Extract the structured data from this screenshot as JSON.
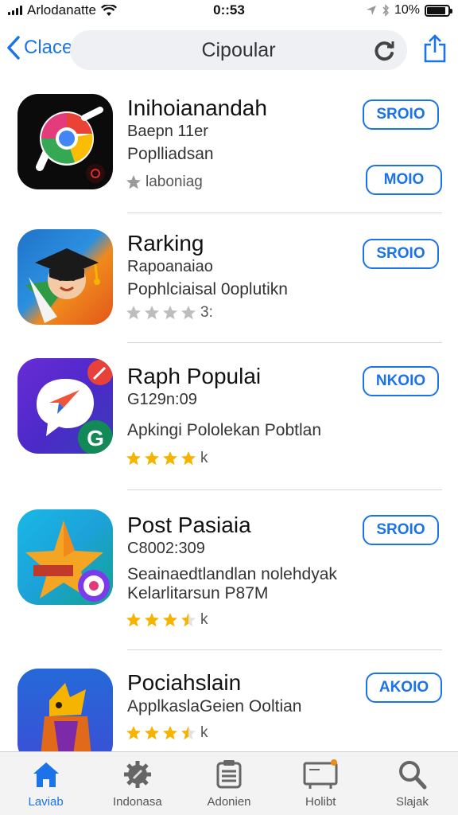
{
  "status_bar": {
    "carrier": "Arlodanatte",
    "time": "0::53",
    "battery": "10%",
    "battery_level": 0.9
  },
  "nav": {
    "back_label": "Clace",
    "title": "Cipoular"
  },
  "apps": [
    {
      "title": "Inihoianandah",
      "line1": "Baepn 11er",
      "line2": "Poplliadsan",
      "rating_text": "laboniag",
      "stars_filled": 1,
      "stars_color": "#9a9a9a",
      "button": "SROIO"
    },
    {
      "title": "Rarking",
      "line1": "Rapoanaiao",
      "line2": "Pophlciaisal 0oplutikn",
      "rating_text": "3:",
      "stars_filled": 4,
      "stars_color": "#bdbdbd",
      "button": "SROIO"
    },
    {
      "title": "Raph Populai",
      "line1": "G129n:09",
      "line2": "Apkingi Pololekan Pobtlan",
      "rating_text": "k",
      "stars_filled": 4,
      "stars_color": "#f5b400",
      "button": "NKOIO"
    },
    {
      "title": "Post Pasiaia",
      "line1": "C8002:309",
      "line2": "Seainaedtlandlan nolehdyak",
      "line3": "Kelarlitarsun P87M",
      "rating_text": "k",
      "stars_filled": 3.5,
      "stars_color": "#f5b400",
      "button": "SROIO"
    },
    {
      "title": "Pociahslain",
      "line1": "ApplkaslaGeien Ooltian",
      "rating_text": "k",
      "stars_filled": 3.5,
      "stars_color": "#f5b400",
      "button": "AKOIO"
    }
  ],
  "tabs": [
    {
      "label": "Laviab",
      "icon": "home-icon",
      "active": true
    },
    {
      "label": "Indonasa",
      "icon": "gear-icon",
      "active": false
    },
    {
      "label": "Adonien",
      "icon": "document-icon",
      "active": false
    },
    {
      "label": "Holibt",
      "icon": "tv-icon",
      "active": false
    },
    {
      "label": "Slajak",
      "icon": "search-icon",
      "active": false
    }
  ],
  "colors": {
    "accent": "#1a73e8",
    "star_gold": "#f5b400"
  }
}
